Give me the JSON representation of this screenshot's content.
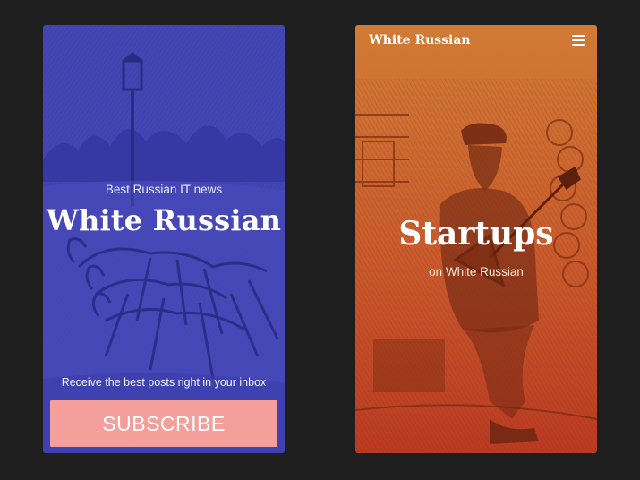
{
  "colors": {
    "page_background": "#1e1e1e",
    "left_screen_tint": "#4345b3",
    "right_screen_tint_top": "#d17b35",
    "right_screen_tint_bottom": "#bb3a22",
    "subscribe_button": "#f59f9c"
  },
  "left_screen": {
    "eyebrow": "Best Russian IT news",
    "title": "White Russian",
    "illustration": "troika-horses-engraving",
    "promo_text": "Receive the best posts right in your inbox",
    "subscribe_label": "SUBSCRIBE"
  },
  "right_screen": {
    "brand": "White Russian",
    "menu_icon": "hamburger-menu-icon",
    "illustration": "balalaika-player-engraving",
    "section_title": "Startups",
    "section_subtitle": "on White Russian"
  }
}
